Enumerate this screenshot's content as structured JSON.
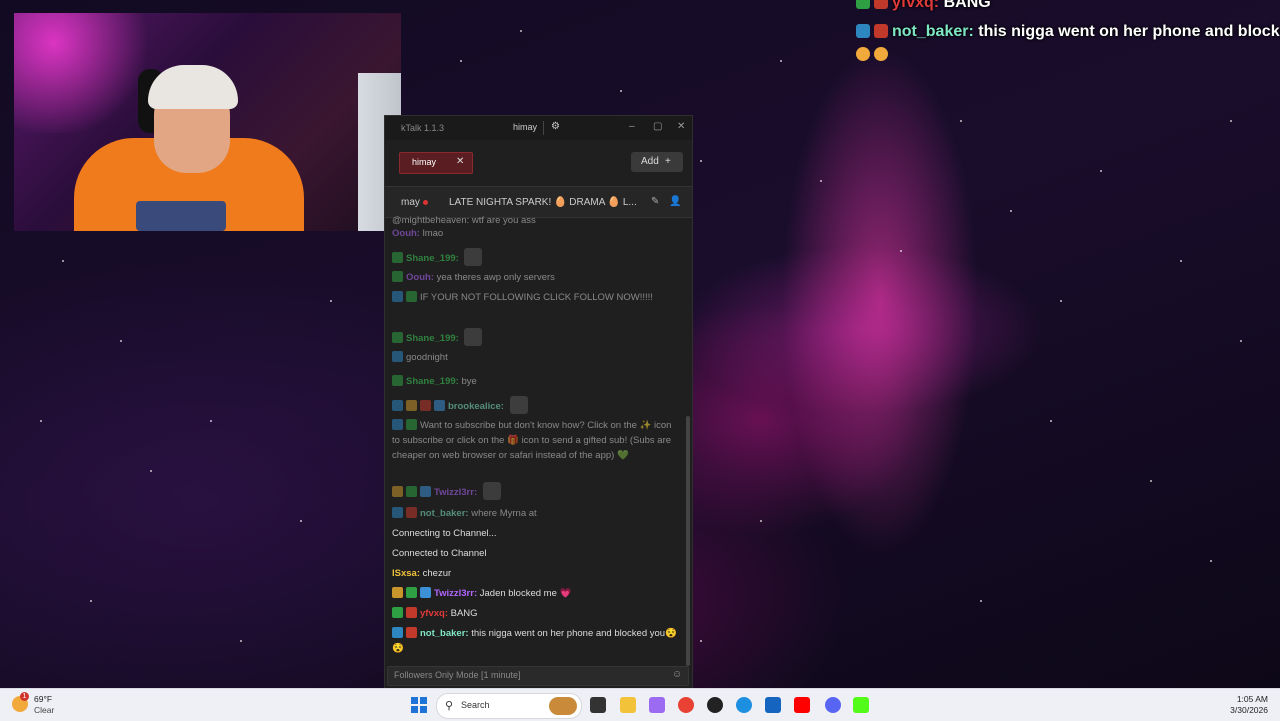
{
  "overlay_chat": [
    {
      "user": "yfvxq:",
      "text": "BANG",
      "user_color": "#e03a3a"
    },
    {
      "user": "not_baker:",
      "text": "this nigga went on her phone and blocked you",
      "user_color": "#7fe7c4"
    }
  ],
  "window": {
    "title": "kTalk 1.1.3",
    "user": "himay",
    "tab_label": "himay",
    "add_label": "Add",
    "channel_name": "may",
    "stream_title": "LATE NIGHTA SPARK! 🥚 DRAMA 🥚 L...",
    "messages": [
      {
        "badges": [],
        "user": "",
        "text": "@mightbeheaven: wtf are you ass",
        "user_color": "#ccc",
        "dim": true
      },
      {
        "badges": [],
        "user": "Oouh:",
        "text": "lmao",
        "user_color": "#b266ff",
        "dim": true
      },
      {
        "badges": [
          "vip"
        ],
        "user": "Shane_199:",
        "text": "",
        "user_color": "#3fcf5a",
        "dim": true
      },
      {
        "badges": [
          "vip"
        ],
        "user": "Oouh:",
        "text": "yea theres awp only servers",
        "user_color": "#b266ff",
        "dim": true
      },
      {
        "badges": [
          "mod",
          "vip"
        ],
        "user": "",
        "text": "IF YOUR NOT FOLLOWING CLICK FOLLOW NOW!!!!!",
        "user_color": "#e03a3a",
        "dim": true
      },
      {
        "badges": [
          "vip"
        ],
        "user": "Shane_199:",
        "text": "",
        "user_color": "#3fcf5a",
        "dim": true
      },
      {
        "badges": [
          "mod"
        ],
        "user": "",
        "text": "goodnight",
        "user_color": "#e03a3a",
        "dim": true
      },
      {
        "badges": [
          "vip"
        ],
        "user": "Shane_199:",
        "text": "bye",
        "user_color": "#3fcf5a",
        "dim": true
      },
      {
        "badges": [
          "mod",
          "sub",
          "pin",
          "cube"
        ],
        "user": "brookealice:",
        "text": "",
        "user_color": "#7fe7c4",
        "dim": true
      },
      {
        "badges": [
          "mod",
          "vip"
        ],
        "user": "",
        "text": "Want to subscribe but don't know how? Click on the ✨ icon to subscribe or click on the 🎁 icon to send a gifted sub! (Subs are cheaper on web browser or safari instead of the app) 💚",
        "user_color": "#e03a3a",
        "dim": true
      },
      {
        "badges": [
          "sub",
          "vip",
          "cube"
        ],
        "user": "Twizzl3rr:",
        "text": "",
        "user_color": "#b266ff",
        "dim": true
      },
      {
        "badges": [
          "mod",
          "pin"
        ],
        "user": "not_baker:",
        "text": "where Myrna at",
        "user_color": "#7fe7c4",
        "dim": true
      },
      {
        "badges": [],
        "user": "",
        "text": "Connecting to Channel...",
        "user_color": "#ddd",
        "dim": false
      },
      {
        "badges": [],
        "user": "",
        "text": "Connected to Channel",
        "user_color": "#ddd",
        "dim": false
      },
      {
        "badges": [],
        "user": "lSxsa:",
        "text": "chezur",
        "user_color": "#f0c23b",
        "dim": false
      },
      {
        "badges": [
          "sub",
          "vip",
          "cube"
        ],
        "user": "Twizzl3rr:",
        "text": "Jaden blocked me 💗",
        "user_color": "#b266ff",
        "dim": false
      },
      {
        "badges": [
          "vip",
          "pin"
        ],
        "user": "yfvxq:",
        "text": "BANG",
        "user_color": "#e03a3a",
        "dim": false
      },
      {
        "badges": [
          "mod",
          "pin"
        ],
        "user": "not_baker:",
        "text": "this nigga went on her phone and blocked you😵😵",
        "user_color": "#7fe7c4",
        "dim": false
      }
    ],
    "input_placeholder": "Followers Only Mode [1 minute]"
  },
  "taskbar": {
    "weather_temp": "69°F",
    "weather_cond": "Clear",
    "weather_badge": "1",
    "search_placeholder": "Search",
    "time": "1:05 AM",
    "date": "3/30/2026"
  }
}
